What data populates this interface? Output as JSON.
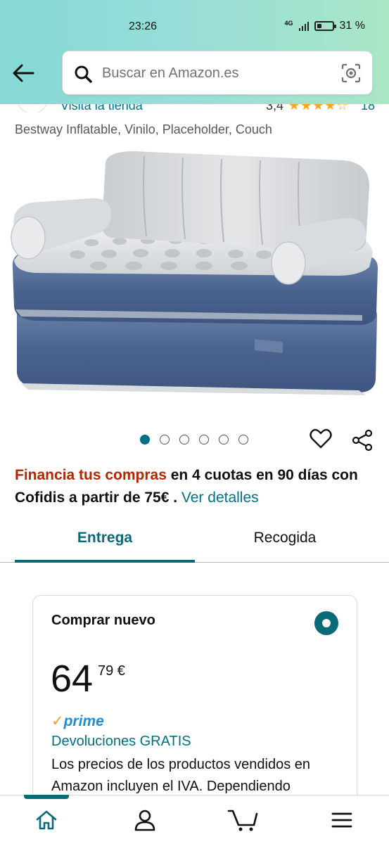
{
  "status_bar": {
    "time": "23:26",
    "network": "4G",
    "battery": "31 %",
    "battery_level": 0.31
  },
  "header": {
    "back_icon": "arrow-left-icon",
    "search_placeholder": "Buscar en Amazon.es",
    "search_icon": "search-icon",
    "camera_icon": "camera-icon"
  },
  "seller_row": {
    "visit_store": "Visita la tienda",
    "rating": "3,4",
    "stars": "★★★★☆",
    "rating_count": "18"
  },
  "product": {
    "subtitle": "Bestway Inflatable, Vinilo, Placeholder, Couch",
    "image_count": 6,
    "active_image_index": 0
  },
  "actions": {
    "heart_icon": "heart-icon",
    "share_icon": "share-icon"
  },
  "financing": {
    "highlight": "Financia tus compras",
    "text": " en 4 cuotas en 90 días con Cofidis a partir de 75€ . ",
    "link": "Ver detalles"
  },
  "tabs": [
    {
      "label": "Entrega",
      "active": true
    },
    {
      "label": "Recogida",
      "active": false
    }
  ],
  "buy_box": {
    "title": "Comprar nuevo",
    "price_whole": "64",
    "price_fraction": "79 €",
    "prime_label": "prime",
    "returns": "Devoluciones GRATIS",
    "tax_text": "Los precios de los productos vendidos en Amazon incluyen el IVA. Dependiendo"
  },
  "bottom_nav": [
    {
      "icon": "home-icon",
      "active": true
    },
    {
      "icon": "user-icon",
      "active": false
    },
    {
      "icon": "cart-icon",
      "active": false
    },
    {
      "icon": "menu-icon",
      "active": false
    }
  ],
  "colors": {
    "accent": "#0b6a77",
    "link": "#007185",
    "financing_red": "#b12704",
    "prime_blue": "#1d8fd6",
    "star": "#ffa41c"
  }
}
